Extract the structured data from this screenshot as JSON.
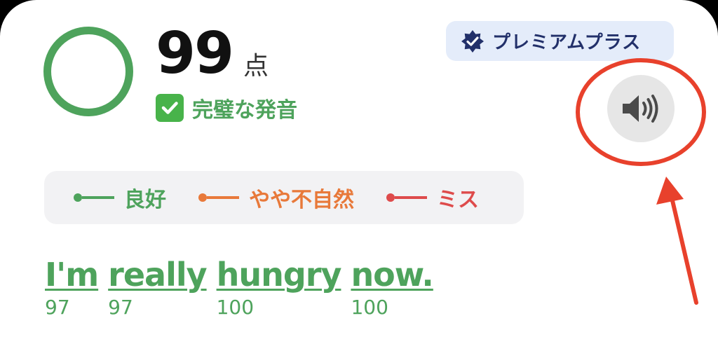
{
  "score": {
    "value": "99",
    "unit": "点",
    "max": 100
  },
  "result": {
    "icon": "check-mark-icon",
    "label": "完璧な発音"
  },
  "premium": {
    "icon": "verified-badge-icon",
    "label": "プレミアムプラス"
  },
  "speaker": {
    "icon": "speaker-icon"
  },
  "annotation": {
    "color": "#e8412c",
    "shapes": [
      "circle-highlight",
      "arrow"
    ]
  },
  "legend": [
    {
      "label": "良好",
      "color": "#4ea35c"
    },
    {
      "label": "やや不自然",
      "color": "#e8793a"
    },
    {
      "label": "ミス",
      "color": "#de4b4b"
    }
  ],
  "sentence": {
    "words": [
      {
        "text": "I'm",
        "score": "97"
      },
      {
        "text": "really",
        "score": "97"
      },
      {
        "text": "hungry",
        "score": "100"
      },
      {
        "text": "now.",
        "score": "100"
      }
    ],
    "color": "#4ea35c"
  }
}
